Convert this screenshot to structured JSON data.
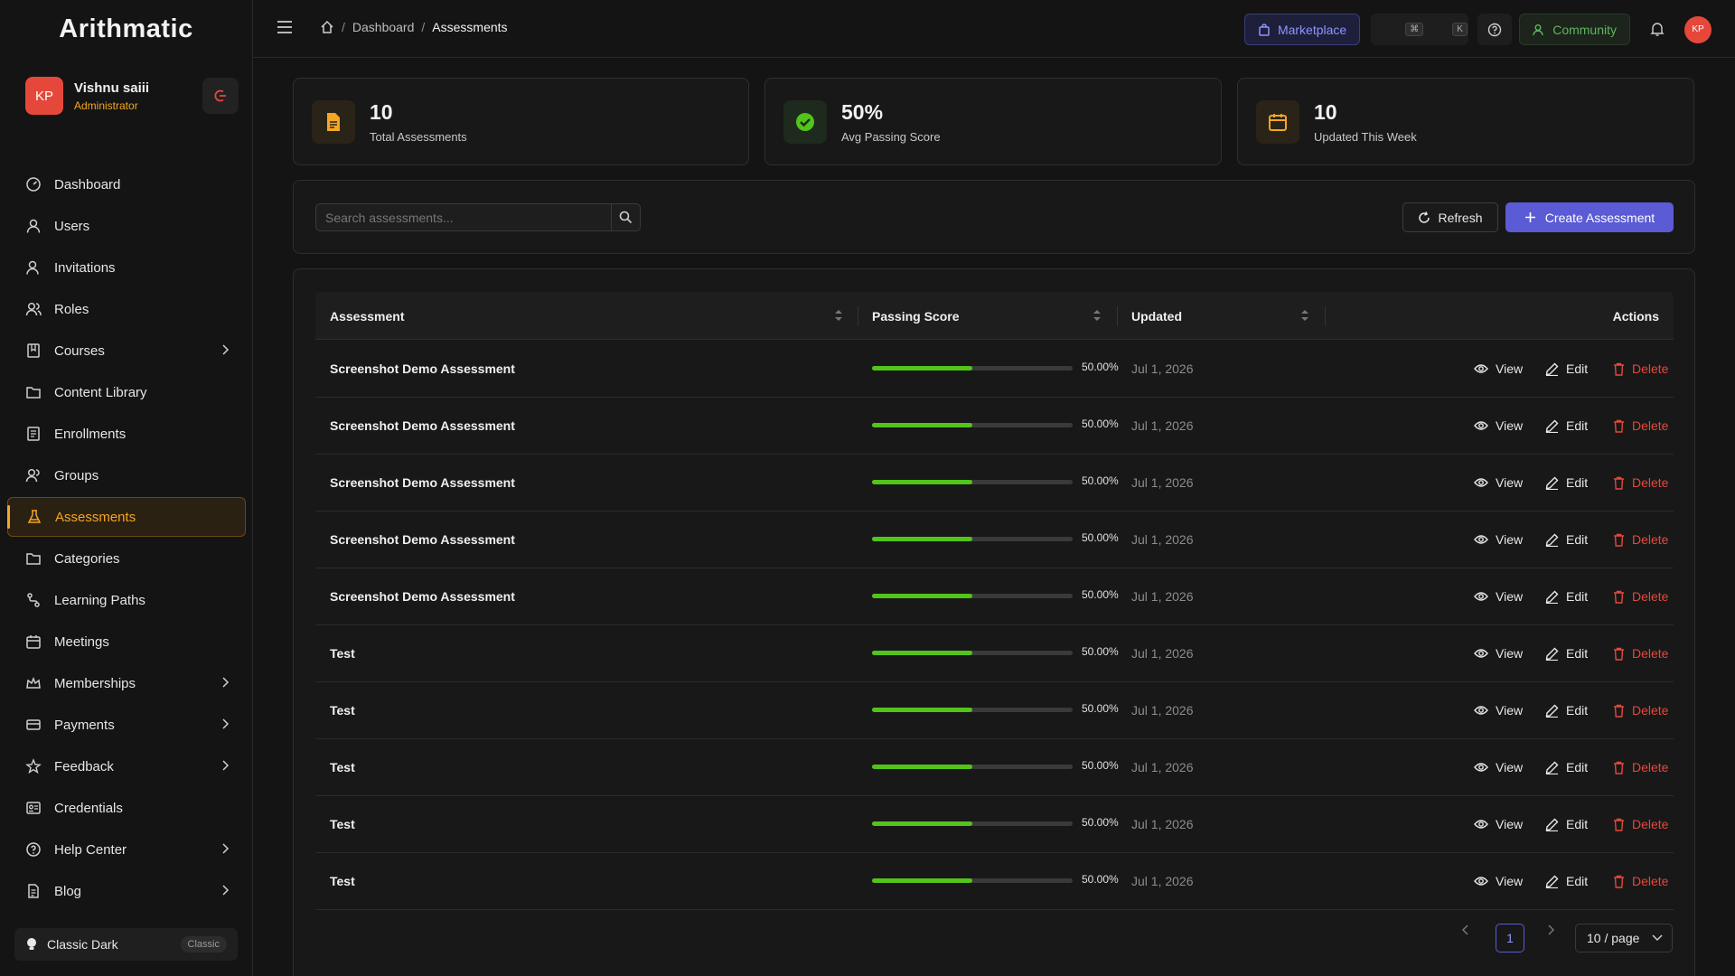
{
  "app": {
    "logo": "Arithmatic"
  },
  "user": {
    "initials": "KP",
    "name": "Vishnu saiii",
    "role": "Administrator"
  },
  "sidebar": {
    "items": [
      {
        "label": "Dashboard",
        "icon": "dashboard-icon",
        "chevron": false,
        "active": false
      },
      {
        "label": "Users",
        "icon": "user-icon",
        "chevron": false,
        "active": false
      },
      {
        "label": "Invitations",
        "icon": "user-add-icon",
        "chevron": false,
        "active": false
      },
      {
        "label": "Roles",
        "icon": "roles-icon",
        "chevron": false,
        "active": false
      },
      {
        "label": "Courses",
        "icon": "book-icon",
        "chevron": true,
        "active": false
      },
      {
        "label": "Content Library",
        "icon": "folder-icon",
        "chevron": false,
        "active": false
      },
      {
        "label": "Enrollments",
        "icon": "enroll-icon",
        "chevron": false,
        "active": false
      },
      {
        "label": "Groups",
        "icon": "group-icon",
        "chevron": false,
        "active": false
      },
      {
        "label": "Assessments",
        "icon": "flask-icon",
        "chevron": false,
        "active": true
      },
      {
        "label": "Categories",
        "icon": "category-folder-icon",
        "chevron": false,
        "active": false
      },
      {
        "label": "Learning Paths",
        "icon": "path-icon",
        "chevron": false,
        "active": false
      },
      {
        "label": "Meetings",
        "icon": "calendar-icon",
        "chevron": false,
        "active": false
      },
      {
        "label": "Memberships",
        "icon": "crown-icon",
        "chevron": true,
        "active": false
      },
      {
        "label": "Payments",
        "icon": "credit-card-icon",
        "chevron": true,
        "active": false
      },
      {
        "label": "Feedback",
        "icon": "star-icon",
        "chevron": true,
        "active": false
      },
      {
        "label": "Credentials",
        "icon": "id-card-icon",
        "chevron": false,
        "active": false
      },
      {
        "label": "Help Center",
        "icon": "help-circle-icon",
        "chevron": true,
        "active": false
      },
      {
        "label": "Blog",
        "icon": "document-icon",
        "chevron": true,
        "active": false
      }
    ],
    "theme": {
      "label": "Classic Dark",
      "badge": "Classic"
    }
  },
  "topbar": {
    "breadcrumb": [
      "Dashboard",
      "Assessments"
    ],
    "marketplace_label": "Marketplace",
    "shortcut_keys": [
      "⌘",
      "K"
    ],
    "community_label": "Community",
    "avatar_initials": "KP"
  },
  "stats": [
    {
      "value": "10",
      "label": "Total Assessments",
      "icon": "file-icon"
    },
    {
      "value": "50%",
      "label": "Avg Passing Score",
      "icon": "check-circle-icon"
    },
    {
      "value": "10",
      "label": "Updated This Week",
      "icon": "calendar-icon"
    }
  ],
  "toolbar": {
    "search_placeholder": "Search assessments...",
    "refresh_label": "Refresh",
    "create_label": "Create Assessment"
  },
  "table": {
    "columns": [
      "Assessment",
      "Passing Score",
      "Updated",
      "Actions"
    ],
    "actions": {
      "view": "View",
      "edit": "Edit",
      "delete": "Delete"
    },
    "rows": [
      {
        "title": "Screenshot Demo Assessment",
        "score": 0.5,
        "score_text": "50.00%",
        "updated": "Jul 1, 2026"
      },
      {
        "title": "Screenshot Demo Assessment",
        "score": 0.5,
        "score_text": "50.00%",
        "updated": "Jul 1, 2026"
      },
      {
        "title": "Screenshot Demo Assessment",
        "score": 0.5,
        "score_text": "50.00%",
        "updated": "Jul 1, 2026"
      },
      {
        "title": "Screenshot Demo Assessment",
        "score": 0.5,
        "score_text": "50.00%",
        "updated": "Jul 1, 2026"
      },
      {
        "title": "Screenshot Demo Assessment",
        "score": 0.5,
        "score_text": "50.00%",
        "updated": "Jul 1, 2026"
      },
      {
        "title": "Test",
        "score": 0.5,
        "score_text": "50.00%",
        "updated": "Jul 1, 2026"
      },
      {
        "title": "Test",
        "score": 0.5,
        "score_text": "50.00%",
        "updated": "Jul 1, 2026"
      },
      {
        "title": "Test",
        "score": 0.5,
        "score_text": "50.00%",
        "updated": "Jul 1, 2026"
      },
      {
        "title": "Test",
        "score": 0.5,
        "score_text": "50.00%",
        "updated": "Jul 1, 2026"
      },
      {
        "title": "Test",
        "score": 0.5,
        "score_text": "50.00%",
        "updated": "Jul 1, 2026"
      }
    ]
  },
  "pagination": {
    "current_page": "1",
    "page_size": "10 / page"
  },
  "colors": {
    "accent": "#f5a623",
    "primary": "#5b5bd6",
    "success": "#52c41a",
    "danger": "#e5483b"
  }
}
